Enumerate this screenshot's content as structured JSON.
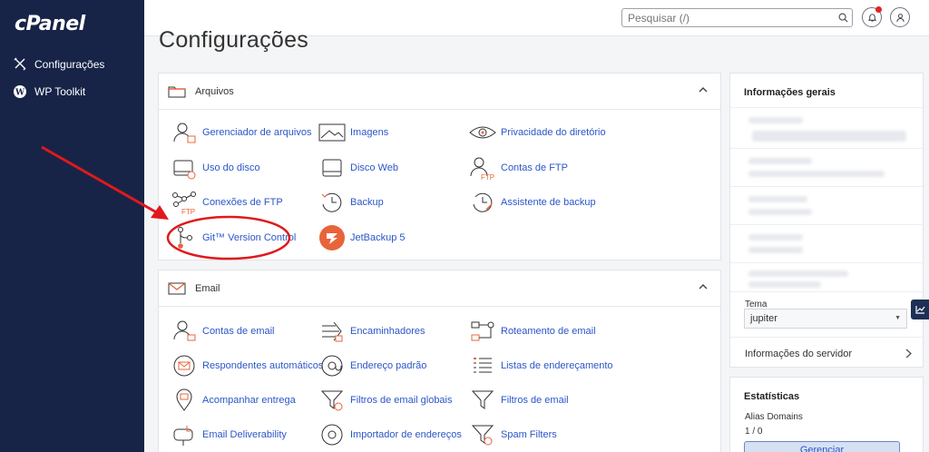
{
  "sidebar": {
    "logo": "cPanel",
    "items": [
      {
        "label": "Configurações",
        "icon": "tools-icon"
      },
      {
        "label": "WP Toolkit",
        "icon": "wordpress-icon"
      }
    ]
  },
  "header": {
    "search_placeholder": "Pesquisar (/)"
  },
  "page": {
    "title": "Configurações"
  },
  "files": {
    "title": "Arquivos",
    "items": [
      {
        "label": "Gerenciador de arquivos",
        "icon": "file-manager-icon"
      },
      {
        "label": "Imagens",
        "icon": "images-icon"
      },
      {
        "label": "Privacidade do diretório",
        "icon": "eye-icon"
      },
      {
        "label": "Uso do disco",
        "icon": "disk-usage-icon"
      },
      {
        "label": "Disco Web",
        "icon": "web-disk-icon"
      },
      {
        "label": "Contas de FTP",
        "icon": "ftp-accounts-icon"
      },
      {
        "label": "Conexões de FTP",
        "icon": "ftp-connections-icon"
      },
      {
        "label": "Backup",
        "icon": "backup-icon"
      },
      {
        "label": "Assistente de backup",
        "icon": "backup-wizard-icon"
      },
      {
        "label": "Git™ Version Control",
        "icon": "git-icon"
      },
      {
        "label": "JetBackup 5",
        "icon": "jetbackup-icon"
      }
    ]
  },
  "email": {
    "title": "Email",
    "items": [
      {
        "label": "Contas de email",
        "icon": "email-accounts-icon"
      },
      {
        "label": "Encaminhadores",
        "icon": "forwarders-icon"
      },
      {
        "label": "Roteamento de email",
        "icon": "email-routing-icon"
      },
      {
        "label": "Respondentes automáticos",
        "icon": "autoresponder-icon"
      },
      {
        "label": "Endereço padrão",
        "icon": "at-icon"
      },
      {
        "label": "Listas de endereçamento",
        "icon": "mailing-list-icon"
      },
      {
        "label": "Acompanhar entrega",
        "icon": "track-delivery-icon"
      },
      {
        "label": "Filtros de email globais",
        "icon": "global-filter-icon"
      },
      {
        "label": "Filtros de email",
        "icon": "filter-icon"
      },
      {
        "label": "Email Deliverability",
        "icon": "mailbox-icon"
      },
      {
        "label": "Importador de endereços",
        "icon": "address-importer-icon"
      },
      {
        "label": "Spam Filters",
        "icon": "spam-filter-icon"
      }
    ]
  },
  "info": {
    "title": "Informações gerais",
    "theme_label": "Tema",
    "theme_value": "jupiter",
    "server_info": "Informações do servidor"
  },
  "stats": {
    "title": "Estatísticas",
    "alias_label": "Alias Domains",
    "alias_value": "1 / 0",
    "manage_label": "Gerenciar"
  },
  "colors": {
    "sidebar_bg": "#172447",
    "link": "#2b56c9",
    "icon_accent": "#e8643b",
    "annotation_red": "#e0191c"
  }
}
